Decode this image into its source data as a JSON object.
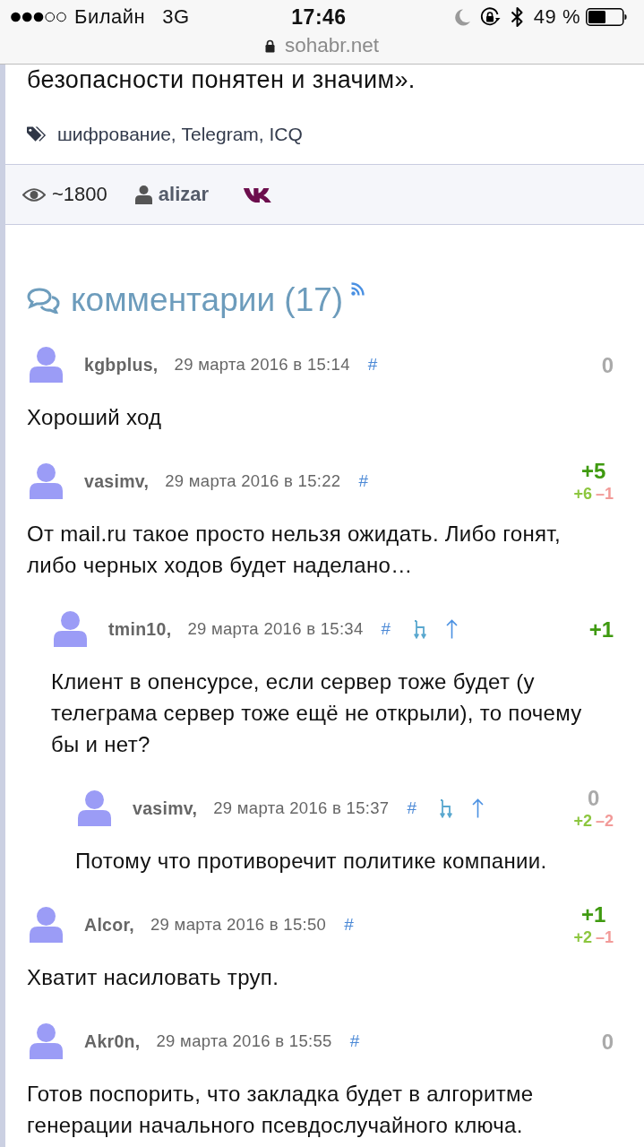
{
  "status_bar": {
    "carrier": "Билайн",
    "network": "3G",
    "time": "17:46",
    "battery_text": "49 %"
  },
  "address_bar": {
    "url": "sohabr.net"
  },
  "article": {
    "text_tail": "безопасности понятен и значим».",
    "tags": "шифрование, Telegram, ICQ",
    "views": "~1800",
    "author": "alizar"
  },
  "comments_section": {
    "title": "комментарии (17)",
    "comments": [
      {
        "author": "kgbplus,",
        "date": "29 марта 2016 в 15:14",
        "anchor": "#",
        "parent_links": false,
        "score": {
          "text": "0",
          "color": "#aaaaaa"
        },
        "text": "Хороший ход"
      },
      {
        "author": "vasimv,",
        "date": "29 марта 2016 в 15:22",
        "anchor": "#",
        "parent_links": false,
        "score": {
          "text": "+5",
          "color": "#3f9a10"
        },
        "votes": {
          "up": "+6",
          "down": "–1"
        },
        "text": "От mail.ru такое просто нельзя ожидать. Либо гонят, либо черных ходов будет наделано…",
        "children": [
          {
            "author": "tmin10,",
            "date": "29 марта 2016 в 15:34",
            "anchor": "#",
            "parent_links": true,
            "score": {
              "text": "+1",
              "color": "#3f9a10"
            },
            "text": "Клиент в опенсурсе, если сервер тоже будет (у телеграма сервер тоже ещё не открыли), то почему бы и нет?",
            "children": [
              {
                "author": "vasimv,",
                "date": "29 марта 2016 в 15:37",
                "anchor": "#",
                "parent_links": true,
                "score": {
                  "text": "0",
                  "color": "#aaaaaa"
                },
                "votes": {
                  "up": "+2",
                  "down": "–2"
                },
                "text": "Потому что противоречит политике компании."
              }
            ]
          }
        ]
      },
      {
        "author": "Alcor,",
        "date": "29 марта 2016 в 15:50",
        "anchor": "#",
        "parent_links": false,
        "score": {
          "text": "+1",
          "color": "#3f9a10"
        },
        "votes": {
          "up": "+2",
          "down": "–1"
        },
        "text": "Хватит насиловать труп."
      },
      {
        "author": "Akr0n,",
        "date": "29 марта 2016 в 15:55",
        "anchor": "#",
        "parent_links": false,
        "score": {
          "text": "0",
          "color": "#aaaaaa"
        },
        "text": "Готов поспорить, что закладка будет в алгоритме генерации начального псевдослучайного ключа."
      }
    ]
  }
}
